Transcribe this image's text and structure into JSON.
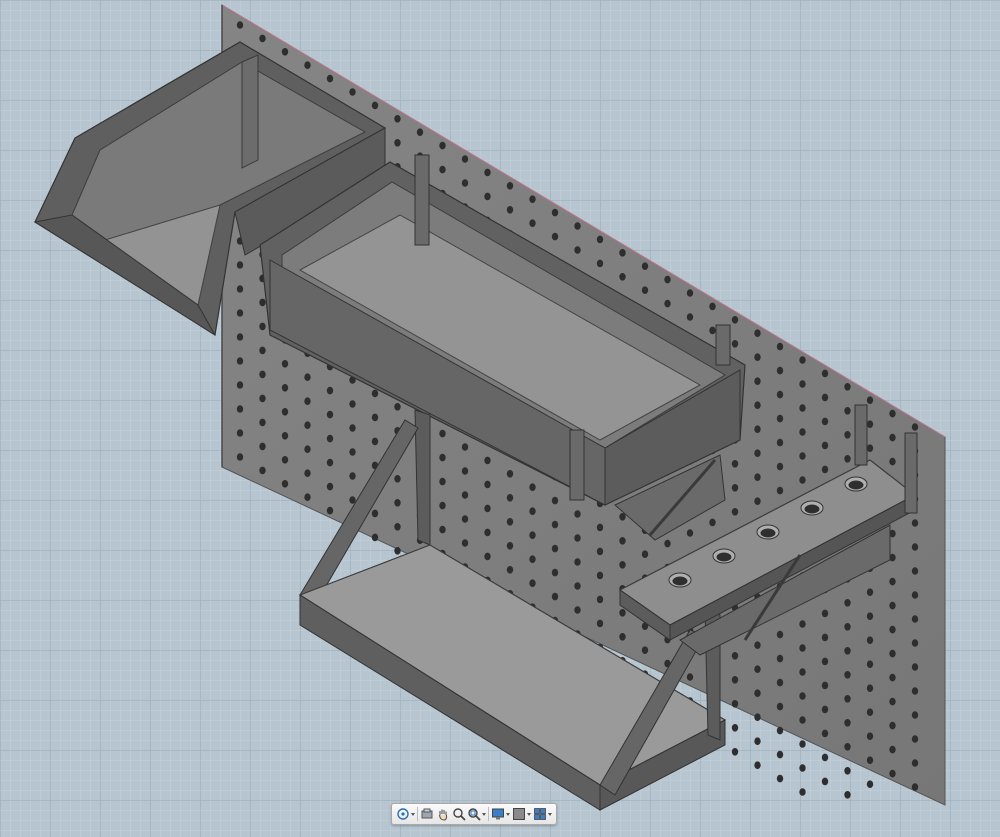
{
  "app": {
    "view": "3D viewport",
    "colors": {
      "background": "#b6c5d0",
      "grid": "#6e879b",
      "model": "#6b6b6b",
      "model_face": "#8f8f8f",
      "pegboard": "#7d7d7d"
    }
  },
  "model": {
    "components": [
      "pegboard",
      "bin",
      "long-tray",
      "shelf",
      "tool-holder"
    ]
  },
  "nav_bar": {
    "tools": [
      {
        "name": "orbit",
        "icon": "orbit-icon",
        "has_menu": true
      },
      {
        "name": "look-at",
        "icon": "look-at-icon",
        "has_menu": false
      },
      {
        "name": "pan",
        "icon": "hand-icon",
        "has_menu": false
      },
      {
        "name": "zoom",
        "icon": "zoom-icon",
        "has_menu": false
      },
      {
        "name": "fit",
        "icon": "zoom-window-icon",
        "has_menu": true
      },
      {
        "name": "display-settings",
        "icon": "display-icon",
        "has_menu": true
      },
      {
        "name": "grid-snaps",
        "icon": "grid-icon",
        "has_menu": true
      },
      {
        "name": "viewports",
        "icon": "viewports-icon",
        "has_menu": true
      }
    ]
  }
}
